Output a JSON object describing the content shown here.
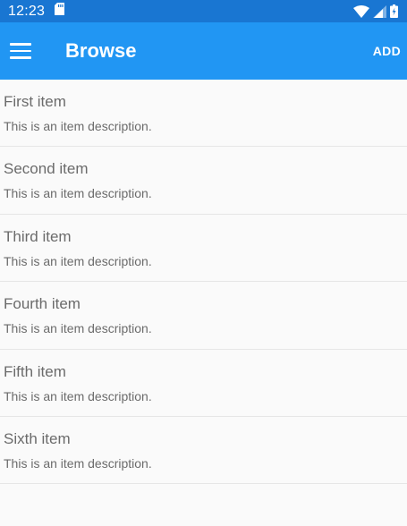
{
  "status_bar": {
    "time": "12:23",
    "icons": [
      "sd-card-icon",
      "wifi-icon",
      "signal-icon",
      "battery-icon"
    ]
  },
  "app_bar": {
    "title": "Browse",
    "add_label": "ADD",
    "menu_icon": "hamburger-menu-icon"
  },
  "items": [
    {
      "title": "First item",
      "description": "This is an item description."
    },
    {
      "title": "Second item",
      "description": "This is an item description."
    },
    {
      "title": "Third item",
      "description": "This is an item description."
    },
    {
      "title": "Fourth item",
      "description": "This is an item description."
    },
    {
      "title": "Fifth item",
      "description": "This is an item description."
    },
    {
      "title": "Sixth item",
      "description": "This is an item description."
    }
  ],
  "colors": {
    "status_bar": "#1976d2",
    "app_bar": "#2196f3",
    "background": "#fafafa",
    "text": "#6b6b6b",
    "divider": "#e6e6e6"
  }
}
